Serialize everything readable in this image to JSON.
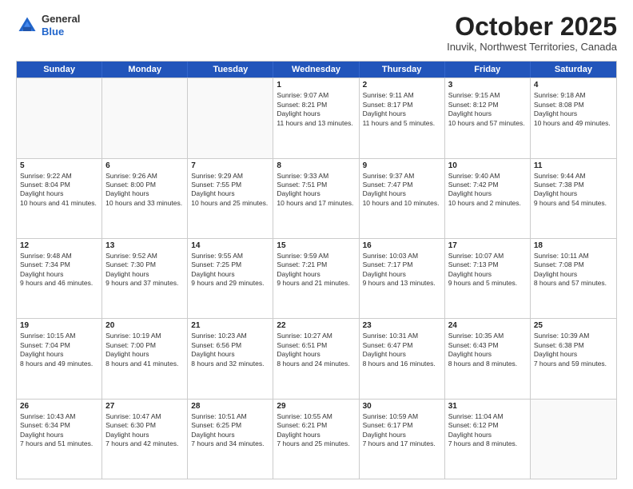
{
  "header": {
    "logo_line1": "General",
    "logo_line2": "Blue",
    "month": "October 2025",
    "location": "Inuvik, Northwest Territories, Canada"
  },
  "days_of_week": [
    "Sunday",
    "Monday",
    "Tuesday",
    "Wednesday",
    "Thursday",
    "Friday",
    "Saturday"
  ],
  "weeks": [
    [
      {
        "day": "",
        "empty": true
      },
      {
        "day": "",
        "empty": true
      },
      {
        "day": "",
        "empty": true
      },
      {
        "day": "1",
        "sunrise": "9:07 AM",
        "sunset": "8:21 PM",
        "daylight": "11 hours and 13 minutes."
      },
      {
        "day": "2",
        "sunrise": "9:11 AM",
        "sunset": "8:17 PM",
        "daylight": "11 hours and 5 minutes."
      },
      {
        "day": "3",
        "sunrise": "9:15 AM",
        "sunset": "8:12 PM",
        "daylight": "10 hours and 57 minutes."
      },
      {
        "day": "4",
        "sunrise": "9:18 AM",
        "sunset": "8:08 PM",
        "daylight": "10 hours and 49 minutes."
      }
    ],
    [
      {
        "day": "5",
        "sunrise": "9:22 AM",
        "sunset": "8:04 PM",
        "daylight": "10 hours and 41 minutes."
      },
      {
        "day": "6",
        "sunrise": "9:26 AM",
        "sunset": "8:00 PM",
        "daylight": "10 hours and 33 minutes."
      },
      {
        "day": "7",
        "sunrise": "9:29 AM",
        "sunset": "7:55 PM",
        "daylight": "10 hours and 25 minutes."
      },
      {
        "day": "8",
        "sunrise": "9:33 AM",
        "sunset": "7:51 PM",
        "daylight": "10 hours and 17 minutes."
      },
      {
        "day": "9",
        "sunrise": "9:37 AM",
        "sunset": "7:47 PM",
        "daylight": "10 hours and 10 minutes."
      },
      {
        "day": "10",
        "sunrise": "9:40 AM",
        "sunset": "7:42 PM",
        "daylight": "10 hours and 2 minutes."
      },
      {
        "day": "11",
        "sunrise": "9:44 AM",
        "sunset": "7:38 PM",
        "daylight": "9 hours and 54 minutes."
      }
    ],
    [
      {
        "day": "12",
        "sunrise": "9:48 AM",
        "sunset": "7:34 PM",
        "daylight": "9 hours and 46 minutes."
      },
      {
        "day": "13",
        "sunrise": "9:52 AM",
        "sunset": "7:30 PM",
        "daylight": "9 hours and 37 minutes."
      },
      {
        "day": "14",
        "sunrise": "9:55 AM",
        "sunset": "7:25 PM",
        "daylight": "9 hours and 29 minutes."
      },
      {
        "day": "15",
        "sunrise": "9:59 AM",
        "sunset": "7:21 PM",
        "daylight": "9 hours and 21 minutes."
      },
      {
        "day": "16",
        "sunrise": "10:03 AM",
        "sunset": "7:17 PM",
        "daylight": "9 hours and 13 minutes."
      },
      {
        "day": "17",
        "sunrise": "10:07 AM",
        "sunset": "7:13 PM",
        "daylight": "9 hours and 5 minutes."
      },
      {
        "day": "18",
        "sunrise": "10:11 AM",
        "sunset": "7:08 PM",
        "daylight": "8 hours and 57 minutes."
      }
    ],
    [
      {
        "day": "19",
        "sunrise": "10:15 AM",
        "sunset": "7:04 PM",
        "daylight": "8 hours and 49 minutes."
      },
      {
        "day": "20",
        "sunrise": "10:19 AM",
        "sunset": "7:00 PM",
        "daylight": "8 hours and 41 minutes."
      },
      {
        "day": "21",
        "sunrise": "10:23 AM",
        "sunset": "6:56 PM",
        "daylight": "8 hours and 32 minutes."
      },
      {
        "day": "22",
        "sunrise": "10:27 AM",
        "sunset": "6:51 PM",
        "daylight": "8 hours and 24 minutes."
      },
      {
        "day": "23",
        "sunrise": "10:31 AM",
        "sunset": "6:47 PM",
        "daylight": "8 hours and 16 minutes."
      },
      {
        "day": "24",
        "sunrise": "10:35 AM",
        "sunset": "6:43 PM",
        "daylight": "8 hours and 8 minutes."
      },
      {
        "day": "25",
        "sunrise": "10:39 AM",
        "sunset": "6:38 PM",
        "daylight": "7 hours and 59 minutes."
      }
    ],
    [
      {
        "day": "26",
        "sunrise": "10:43 AM",
        "sunset": "6:34 PM",
        "daylight": "7 hours and 51 minutes."
      },
      {
        "day": "27",
        "sunrise": "10:47 AM",
        "sunset": "6:30 PM",
        "daylight": "7 hours and 42 minutes."
      },
      {
        "day": "28",
        "sunrise": "10:51 AM",
        "sunset": "6:25 PM",
        "daylight": "7 hours and 34 minutes."
      },
      {
        "day": "29",
        "sunrise": "10:55 AM",
        "sunset": "6:21 PM",
        "daylight": "7 hours and 25 minutes."
      },
      {
        "day": "30",
        "sunrise": "10:59 AM",
        "sunset": "6:17 PM",
        "daylight": "7 hours and 17 minutes."
      },
      {
        "day": "31",
        "sunrise": "11:04 AM",
        "sunset": "6:12 PM",
        "daylight": "7 hours and 8 minutes."
      },
      {
        "day": "",
        "empty": true
      }
    ]
  ]
}
